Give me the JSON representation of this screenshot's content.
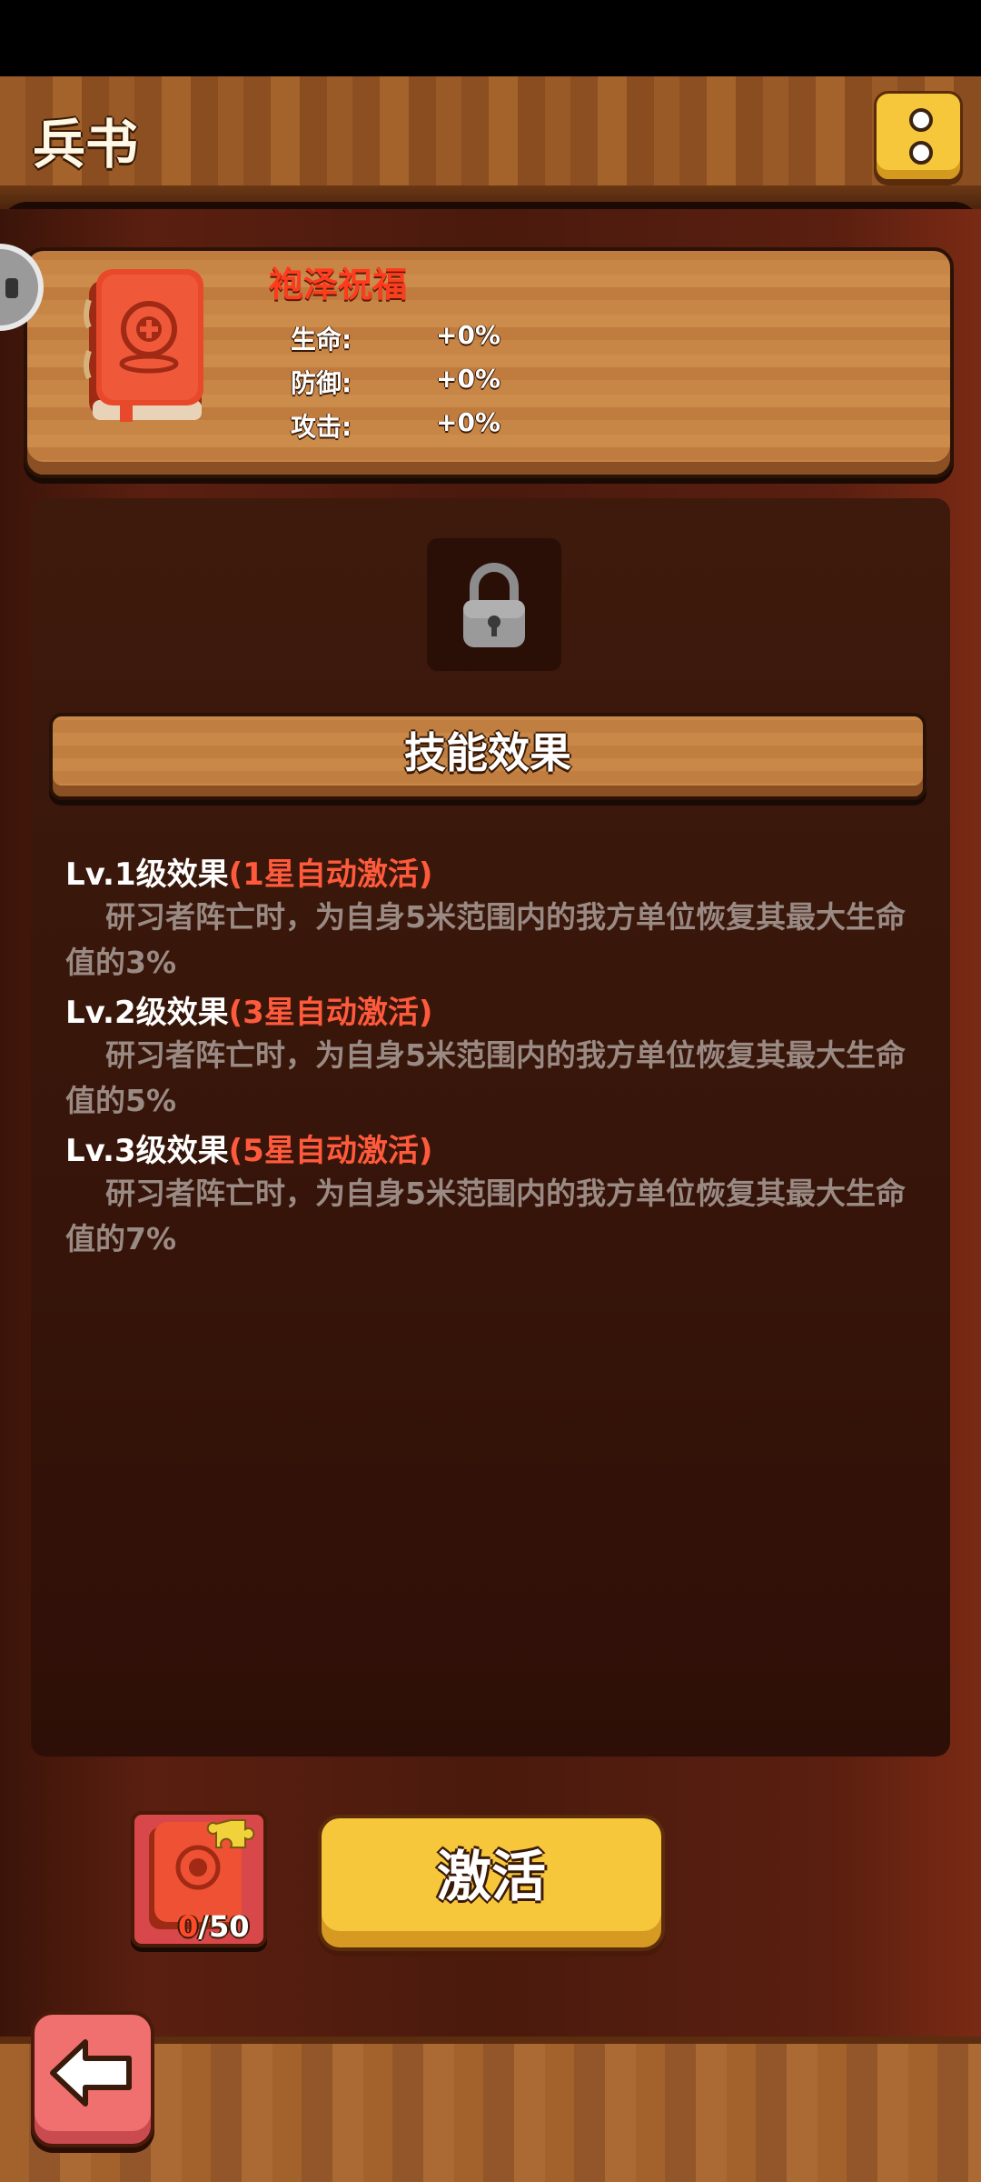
{
  "header": {
    "title": "兵书",
    "menu_icon": "menu-dots-icon"
  },
  "book": {
    "name": "袍泽祝福",
    "icon": "red-book-icon",
    "stats": [
      {
        "label": "生命:",
        "value": "+0%"
      },
      {
        "label": "防御:",
        "value": "+0%"
      },
      {
        "label": "攻击:",
        "value": "+0%"
      }
    ]
  },
  "lock_icon": "padlock-icon",
  "skill": {
    "header": "技能效果",
    "levels": [
      {
        "prefix": "Lv.1级效果",
        "condition": "(1星自动激活)",
        "desc": "研习者阵亡时，为自身5米范围内的我方单位恢复其最大生命值的3%"
      },
      {
        "prefix": "Lv.2级效果",
        "condition": "(3星自动激活)",
        "desc": "研习者阵亡时，为自身5米范围内的我方单位恢复其最大生命值的5%"
      },
      {
        "prefix": "Lv.3级效果",
        "condition": "(5星自动激活)",
        "desc": "研习者阵亡时，为自身5米范围内的我方单位恢复其最大生命值的7%"
      }
    ]
  },
  "fragments": {
    "owned": "0",
    "required": "/50",
    "icon": "book-fragment-icon"
  },
  "activate_label": "激活",
  "back_icon": "back-arrow-icon",
  "colors": {
    "accent_yellow": "#f6c63b",
    "title_red": "#ff3b1e",
    "condition_red": "#ff5a3c",
    "back_pink": "#f07070"
  }
}
